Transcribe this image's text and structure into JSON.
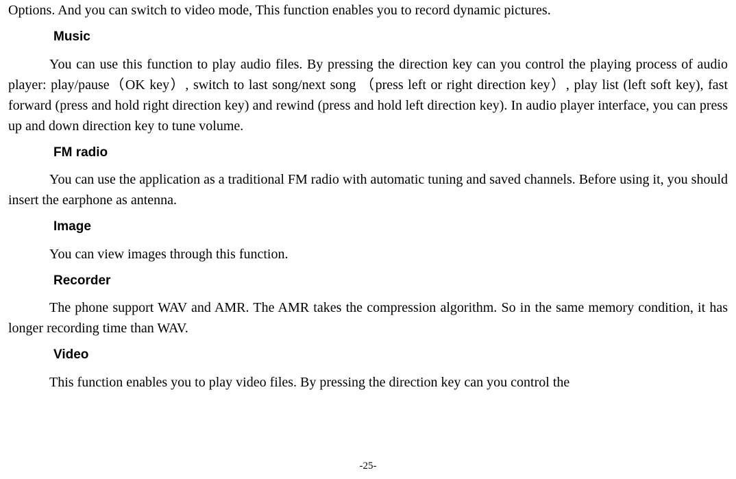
{
  "p_intro": "Options. And you can switch to video mode, This function enables you to record dynamic pictures.",
  "h_music": "Music",
  "p_music": "You can use this function to play audio files. By pressing the direction key can you control the playing process of audio player: play/pause（OK key）, switch to last song/next song  （press left or right direction key）, play list (left soft key), fast forward (press and hold right direction key) and rewind (press and hold left direction key). In audio player interface, you can press up and down direction key to tune volume.",
  "h_fm": "FM radio",
  "p_fm": "You can use the application as a traditional FM radio with automatic tuning and saved channels. Before using it, you should insert the earphone as antenna.",
  "h_image": "Image",
  "p_image": "You can view images through this function.",
  "h_recorder": "Recorder",
  "p_recorder": "The phone support WAV and AMR. The AMR takes the compression algorithm. So in the same memory condition, it has longer recording time than WAV.",
  "h_video": "Video",
  "p_video": "This function enables you to play video files. By pressing the direction key can you control the",
  "page_number": "-25-"
}
